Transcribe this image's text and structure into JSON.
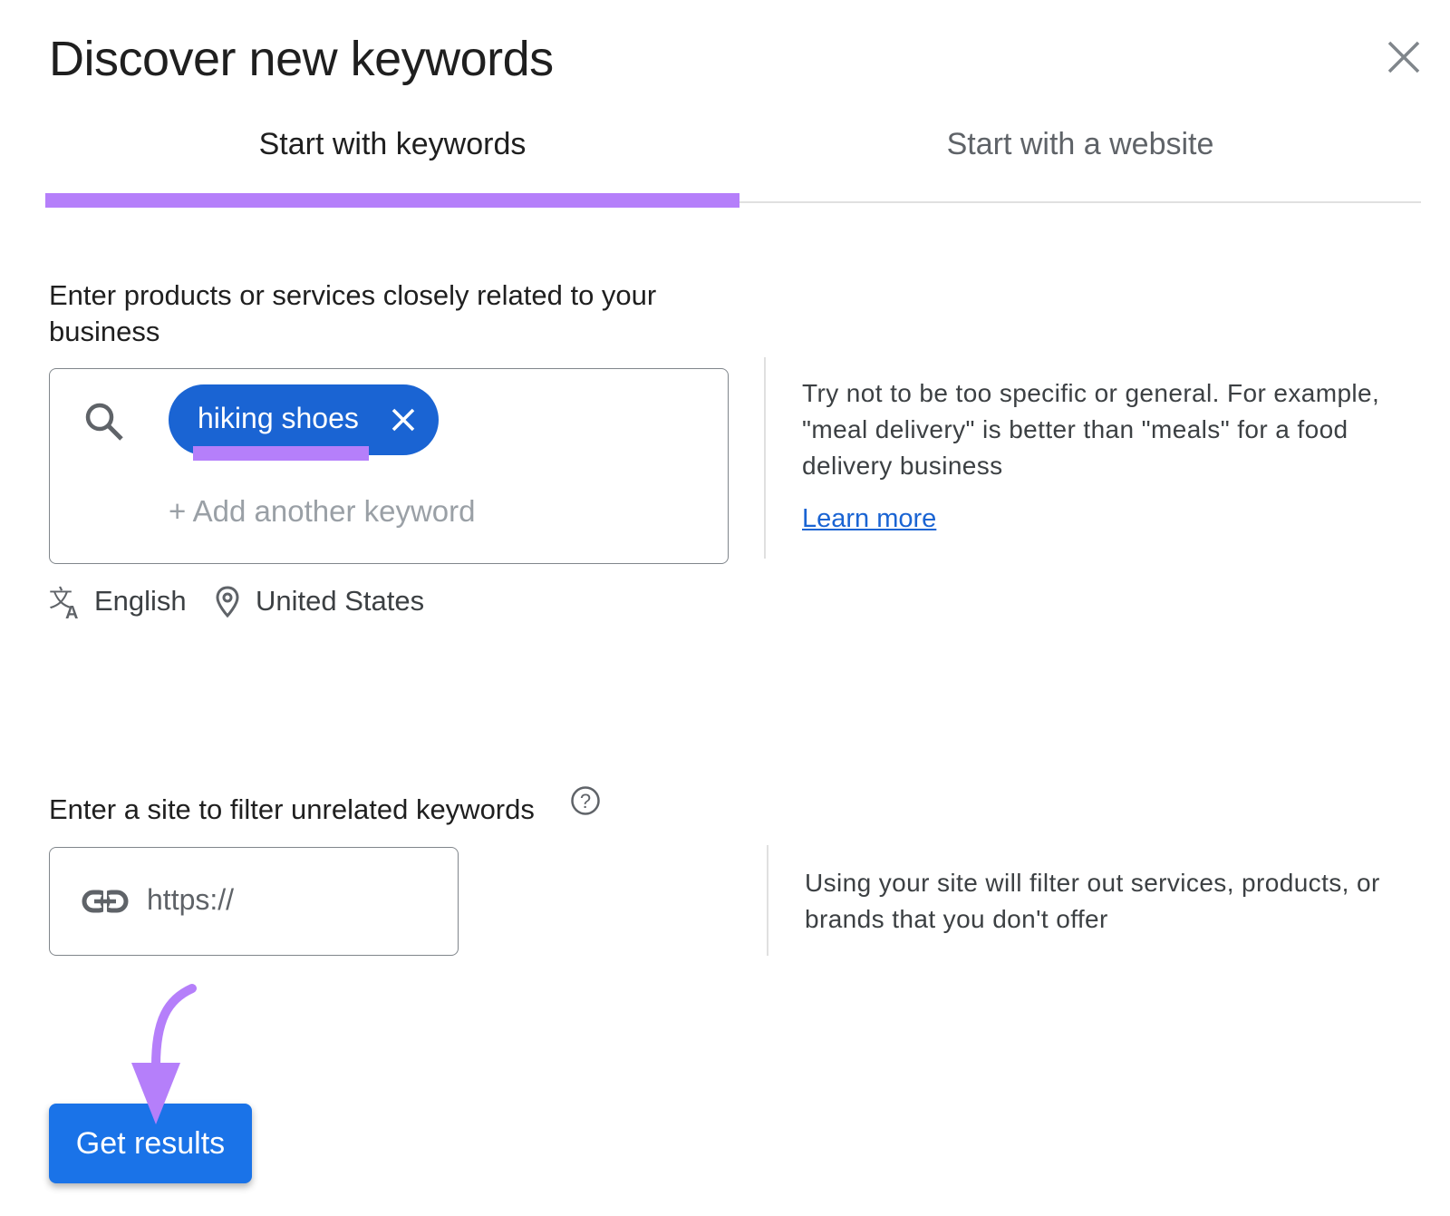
{
  "dialog": {
    "title": "Discover new keywords",
    "close_icon": "close-icon"
  },
  "tabs": [
    {
      "label": "Start with keywords",
      "active": true
    },
    {
      "label": "Start with a website",
      "active": false
    }
  ],
  "keywords_section": {
    "label": "Enter products or services closely related to your business",
    "search_icon": "search-icon",
    "chips": [
      {
        "label": "hiking shoes",
        "remove_icon": "close-icon"
      }
    ],
    "add_placeholder": "+ Add another keyword",
    "language": "English",
    "location": "United States",
    "hint": "Try not to be too specific or general. For example, \"meal delivery\" is better than \"meals\" for a food delivery business",
    "learn_more": "Learn more"
  },
  "site_section": {
    "label": "Enter a site to filter unrelated keywords",
    "help_icon": "help-circle-icon",
    "placeholder": "https://",
    "link_icon": "link-icon",
    "hint": "Using your site will filter out services, products, or brands that you don't offer"
  },
  "actions": {
    "get_results": "Get results"
  },
  "colors": {
    "accent_annotation": "#b57ffa",
    "primary_blue": "#1a73e8",
    "chip_blue": "#1a64d3"
  }
}
